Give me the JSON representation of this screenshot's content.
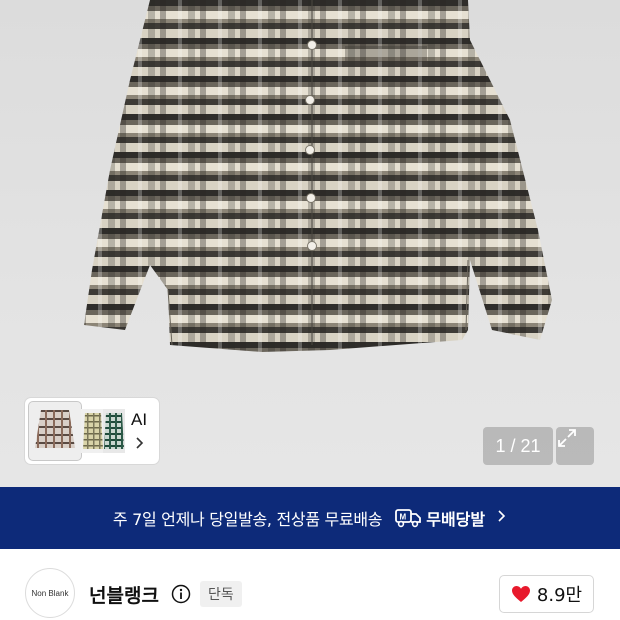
{
  "gallery": {
    "ai_label": "AI",
    "counter": "1 / 21"
  },
  "banner": {
    "text": "주 7일 언제나 당일발송, 전상품 무료배송",
    "free_shipping_label": "무배당발",
    "bg_color": "#0d2a79"
  },
  "store": {
    "logo_text": "Non Blank",
    "name": "넌블랭크",
    "badge": "단독",
    "likes": "8.9만",
    "heart_color": "#e8192c"
  },
  "icons": {
    "info": "info-icon",
    "heart": "heart-icon",
    "expand": "expand-icon",
    "chevron": "chevron-right-icon",
    "truck": "truck-icon"
  }
}
